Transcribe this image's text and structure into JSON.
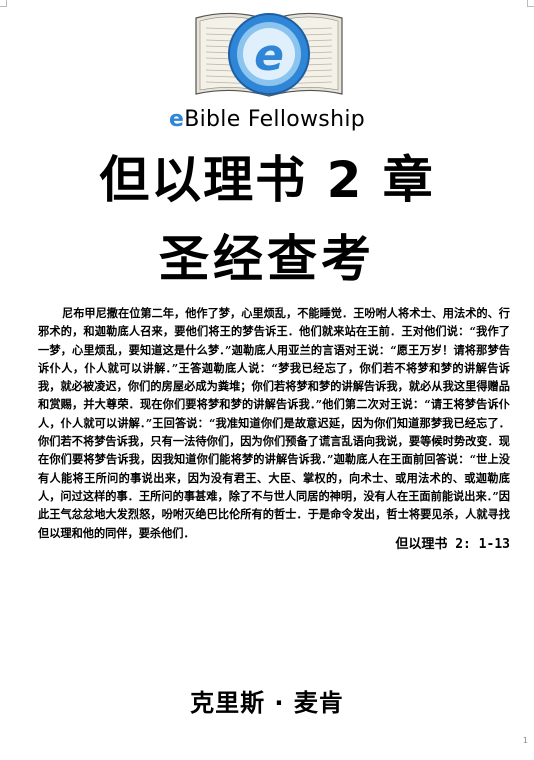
{
  "brand": {
    "prefix": "e",
    "rest": "Bible Fellowship"
  },
  "logo": {
    "letter": "e",
    "colors": {
      "ring": "#2f86d6",
      "ring_light": "#8cc4f0",
      "book": "#f2eee4"
    }
  },
  "title_line1": "但以理书 2 章",
  "title_line2": "圣经查考",
  "passage": "尼布甲尼撒在位第二年，他作了梦，心里烦乱，不能睡觉．王吩咐人将术士、用法术的、行邪术的，和迦勒底人召来，要他们将王的梦告诉王．他们就来站在王前．王对他们说：“我作了一梦，心里烦乱，要知道这是什么梦．”迦勒底人用亚兰的言语对王说：“愿王万岁！请将那梦告诉仆人，仆人就可以讲解．”王答迦勒底人说：“梦我已经忘了，你们若不将梦和梦的讲解告诉我，就必被凌迟，你们的房屋必成为粪堆；你们若将梦和梦的讲解告诉我，就必从我这里得赠品和赏赐，并大尊荣．现在你们要将梦和梦的讲解告诉我．”他们第二次对王说：“请王将梦告诉仆人，仆人就可以讲解．”王回答说：“我准知道你们是故意迟延，因为你们知道那梦我已经忘了．你们若不将梦告诉我，只有一法待你们，因为你们预备了谎言乱语向我说，要等候时势改变．现在你们要将梦告诉我，因我知道你们能将梦的讲解告诉我．”迦勒底人在王面前回答说：“世上没有人能将王所问的事说出来，因为没有君王、大臣、掌权的，向术士、或用法术的、或迦勒底人，问过这样的事．王所问的事甚难，除了不与世人同居的神明，没有人在王面前能说出来．”因此王气忿忿地大发烈怒，吩咐灭绝巴比伦所有的哲士．于是命令发出，哲士将要见杀，人就寻找但以理和他的同伴，要杀他们．",
  "reference": "但以理书 2: 1-13",
  "author": "克里斯 · 麦肯",
  "page_number": "1"
}
